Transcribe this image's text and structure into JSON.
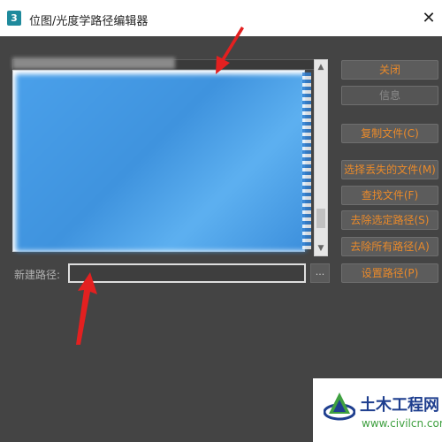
{
  "window": {
    "icon_glyph": "3",
    "title": "位图/光度学路径编辑器",
    "close_glyph": "✕"
  },
  "scrollbar": {
    "up_glyph": "▲",
    "down_glyph": "▼"
  },
  "new_path": {
    "label": "新建路径:",
    "value": "",
    "browse_label": "..."
  },
  "buttons": {
    "close": "关闭",
    "info": "信息",
    "copy_files": "复制文件(C)",
    "select_missing": "选择丢失的文件(M)",
    "find_files": "查找文件(F)",
    "strip_selected": "去除选定路径(S)",
    "strip_all": "去除所有路径(A)",
    "set_path": "设置路径(P)"
  },
  "watermark": {
    "name": "土木工程网",
    "url": "www.civilcn.com"
  },
  "colors": {
    "accent": "#ea8a2a",
    "arrow": "#e32020",
    "background": "#444444"
  }
}
